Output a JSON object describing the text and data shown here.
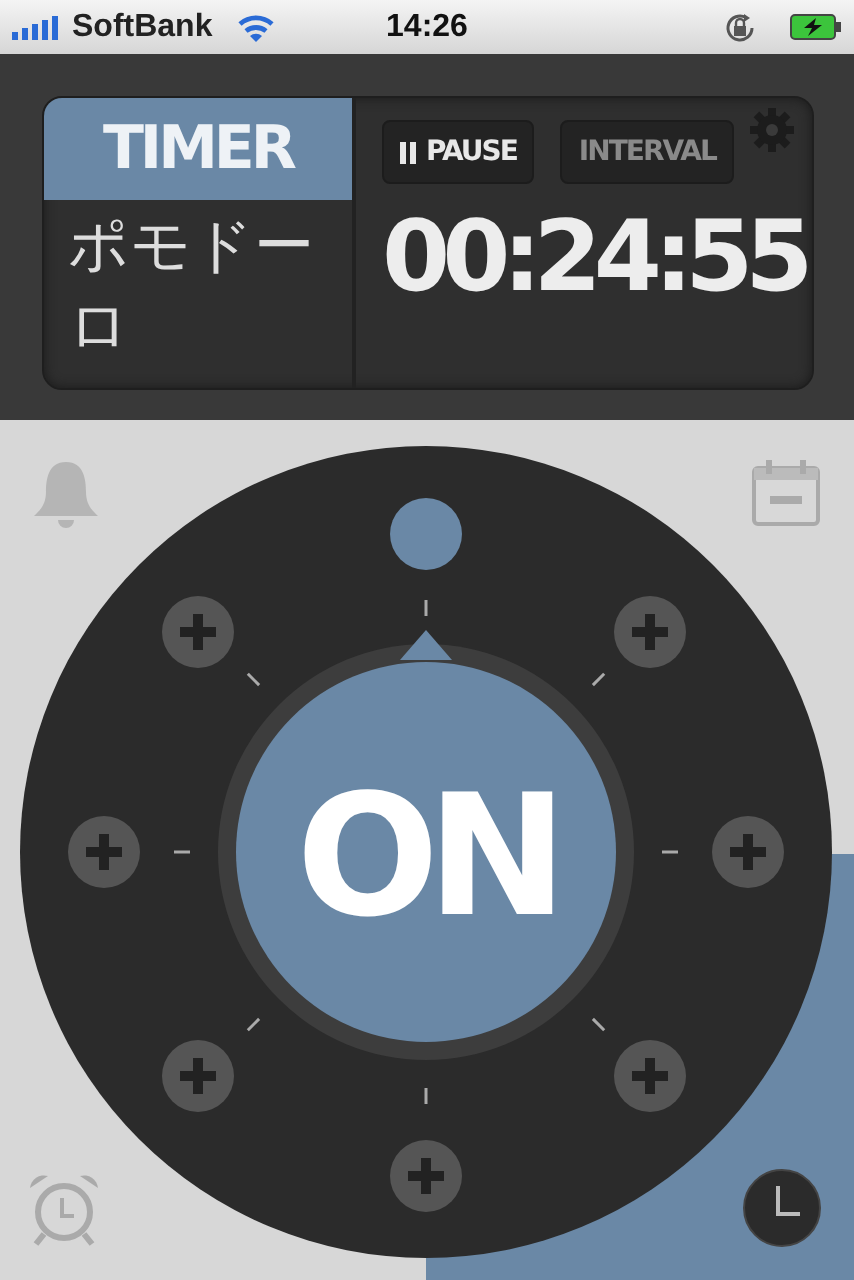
{
  "status_bar": {
    "carrier": "SoftBank",
    "time": "14:26"
  },
  "mode_tab": {
    "label": "TIMER",
    "selected": true
  },
  "timer_name": "ポモドーロ",
  "buttons": [
    {
      "kind": "pause",
      "label": "PAUSE",
      "disabled": false
    },
    {
      "kind": "interval",
      "label": "INTERVAL",
      "disabled": true
    }
  ],
  "time": "00:24:55",
  "dial": {
    "label": "ON",
    "on": true
  }
}
